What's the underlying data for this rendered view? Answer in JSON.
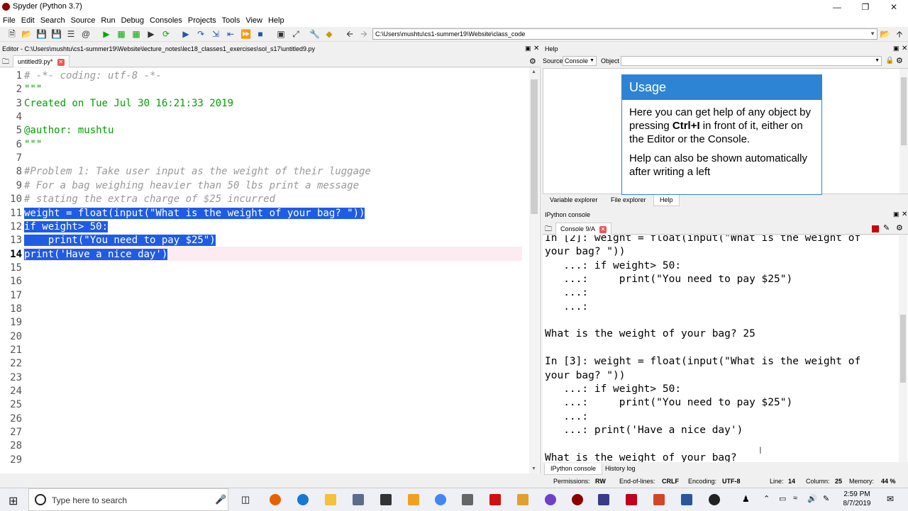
{
  "window": {
    "title": "Spyder (Python 3.7)"
  },
  "menu": [
    "File",
    "Edit",
    "Search",
    "Source",
    "Run",
    "Debug",
    "Consoles",
    "Projects",
    "Tools",
    "View",
    "Help"
  ],
  "toolbar": {
    "path": "C:\\Users\\mushtu\\cs1-summer19\\Website\\class_code"
  },
  "editor": {
    "title": "Editor - C:\\Users\\mushtu\\cs1-summer19\\Website\\lecture_notes\\lec18_classes1_exercises\\sol_s17\\untitled9.py",
    "tab": "untitled9.py*",
    "lines": [
      "# -*- coding: utf-8 -*-",
      "\"\"\"",
      "Created on Tue Jul 30 16:21:33 2019",
      "",
      "@author: mushtu",
      "\"\"\"",
      "",
      "#Problem 1: Take user input as the weight of their luggage",
      "# For a bag weighing heavier than 50 lbs print a message",
      "# stating the extra charge of $25 incurred",
      "weight = float(input(\"What is the weight of your bag? \"))",
      "if weight> 50:",
      "    print(\"You need to pay $25\")",
      "print('Have a nice day')",
      "",
      "",
      "",
      "",
      "",
      "",
      "",
      "",
      "",
      "",
      "",
      "",
      "",
      "",
      ""
    ],
    "line_numbers": [
      "1",
      "2",
      "3",
      "4",
      "5",
      "6",
      "7",
      "8",
      "9",
      "10",
      "11",
      "12",
      "13",
      "14",
      "15",
      "16",
      "17",
      "18",
      "19",
      "20",
      "21",
      "22",
      "23",
      "24",
      "25",
      "26",
      "27",
      "28",
      "29"
    ],
    "current_line": "14"
  },
  "help": {
    "title": "Help",
    "source_label": "Source",
    "source_value": "Console",
    "object_label": "Object",
    "usage_title": "Usage",
    "usage_p1_pre": "Here you can get help of any object by pressing ",
    "usage_p1_key": "Ctrl+I",
    "usage_p1_post": " in front of it, either on the Editor or the Console.",
    "usage_p2": "Help can also be shown automatically after writing a left",
    "tabs": [
      "Variable explorer",
      "File explorer",
      "Help"
    ]
  },
  "ipython": {
    "title": "IPython console",
    "tab": "Console 9/A",
    "lines": [
      "In [2]: weight = float(input(\"What is the weight of",
      "your bag? \"))",
      "   ...: if weight> 50:",
      "   ...:     print(\"You need to pay $25\")",
      "   ...:",
      "   ...:",
      "",
      "What is the weight of your bag? 25",
      "",
      "In [3]: weight = float(input(\"What is the weight of",
      "your bag? \"))",
      "   ...: if weight> 50:",
      "   ...:     print(\"You need to pay $25\")",
      "   ...:",
      "   ...: print('Have a nice day')",
      "",
      "What is the weight of your bag? "
    ],
    "bottom_tabs": [
      "IPython console",
      "History log"
    ]
  },
  "status": {
    "permissions_label": "Permissions:",
    "permissions": "RW",
    "eol_label": "End-of-lines:",
    "eol": "CRLF",
    "encoding_label": "Encoding:",
    "encoding": "UTF-8",
    "line_label": "Line:",
    "line": "14",
    "column_label": "Column:",
    "column": "25",
    "memory_label": "Memory:",
    "memory": "44 %"
  },
  "taskbar": {
    "search_placeholder": "Type here to search",
    "time": "2:59 PM",
    "date": "8/7/2019"
  }
}
